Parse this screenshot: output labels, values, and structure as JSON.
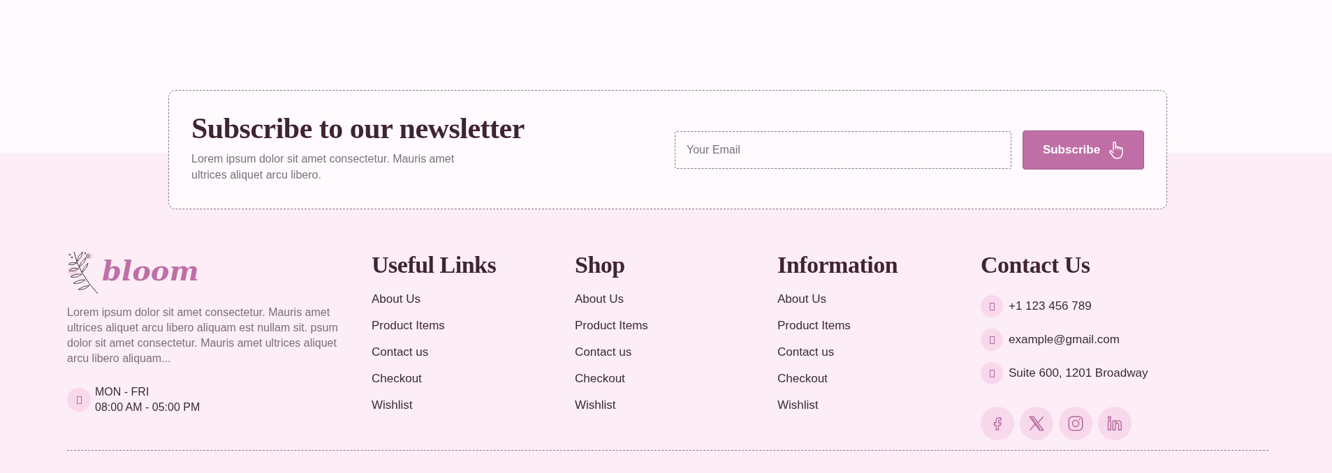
{
  "newsletter": {
    "heading": "Subscribe to our newsletter",
    "text": "Lorem ipsum dolor sit amet consectetur. Mauris amet ultrices aliquet arcu libero.",
    "email_placeholder": "Your Email",
    "button": "Subscribe"
  },
  "footer": {
    "brand": "bloom",
    "description": "Lorem ipsum dolor sit amet consectetur. Mauris amet ultrices aliquet arcu libero aliquam est nullam sit. psum dolor sit amet consectetur. Mauris amet ultrices aliquet arcu libero aliquam...",
    "hours": {
      "days": "MON - FRI",
      "time": "08:00 AM - 05:00 PM"
    },
    "columns": [
      {
        "heading": "Useful Links",
        "links": [
          "About Us",
          "Product Items",
          "Contact us",
          "Checkout",
          "Wishlist"
        ]
      },
      {
        "heading": "Shop",
        "links": [
          "About Us",
          "Product Items",
          "Contact us",
          "Checkout",
          "Wishlist"
        ]
      },
      {
        "heading": "Information",
        "links": [
          "About Us",
          "Product Items",
          "Contact us",
          "Checkout",
          "Wishlist"
        ]
      }
    ],
    "contact": {
      "heading": "Contact Us",
      "items": [
        "+1 123 456 789",
        "example@gmail.com",
        "Suite 600, 1201 Broadway"
      ]
    }
  }
}
